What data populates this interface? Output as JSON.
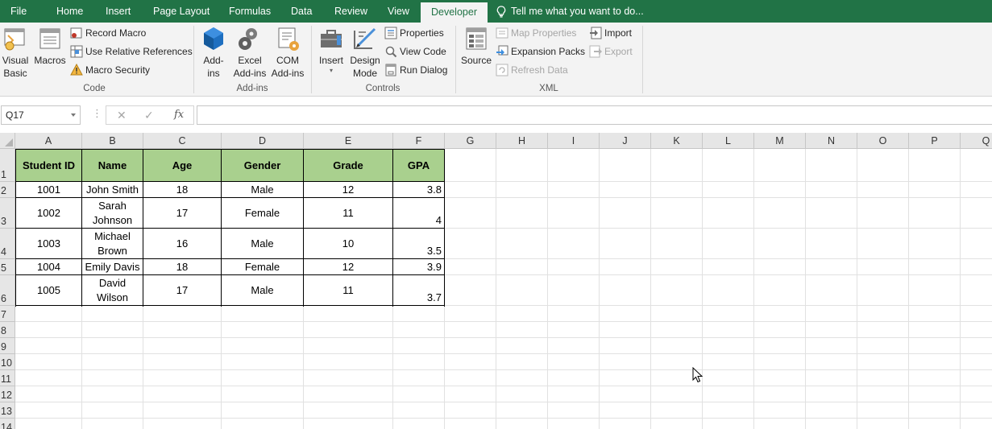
{
  "tabs": [
    {
      "label": "File"
    },
    {
      "label": "Home"
    },
    {
      "label": "Insert"
    },
    {
      "label": "Page Layout"
    },
    {
      "label": "Formulas"
    },
    {
      "label": "Data"
    },
    {
      "label": "Review"
    },
    {
      "label": "View"
    },
    {
      "label": "Developer"
    }
  ],
  "active_tab": "Developer",
  "tell_me": "Tell me what you want to do...",
  "ribbon": {
    "code": {
      "label": "Code",
      "visual_basic": [
        "Visual",
        "Basic"
      ],
      "macros": "Macros",
      "record_macro": "Record Macro",
      "relative_refs": "Use Relative References",
      "macro_security": "Macro Security"
    },
    "addins": {
      "label": "Add-ins",
      "addins": [
        "Add-",
        "ins"
      ],
      "excel_addins": [
        "Excel",
        "Add-ins"
      ],
      "com_addins": [
        "COM",
        "Add-ins"
      ]
    },
    "controls": {
      "label": "Controls",
      "insert": "Insert",
      "design_mode": [
        "Design",
        "Mode"
      ],
      "properties": "Properties",
      "view_code": "View Code",
      "run_dialog": "Run Dialog"
    },
    "xml": {
      "label": "XML",
      "source": "Source",
      "map_properties": "Map Properties",
      "expansion_packs": "Expansion Packs",
      "refresh_data": "Refresh Data",
      "import": "Import",
      "export": "Export"
    }
  },
  "formula_bar": {
    "name_box": "Q17",
    "fx": "fx",
    "formula": ""
  },
  "columns": [
    "A",
    "B",
    "C",
    "D",
    "E",
    "F",
    "G",
    "H",
    "I",
    "J",
    "K",
    "L",
    "M",
    "N",
    "O",
    "P",
    "Q"
  ],
  "rows": [
    "1",
    "2",
    "3",
    "4",
    "5",
    "6",
    "7",
    "8",
    "9",
    "10",
    "11",
    "12",
    "13",
    "14"
  ],
  "table": {
    "headers": [
      "Student ID",
      "Name",
      "Age",
      "Gender",
      "Grade",
      "GPA"
    ],
    "rows": [
      {
        "id": "1001",
        "name": [
          "John Smith"
        ],
        "age": "18",
        "gender": "Male",
        "grade": "12",
        "gpa": "3.8"
      },
      {
        "id": "1002",
        "name": [
          "Sarah",
          "Johnson"
        ],
        "age": "17",
        "gender": "Female",
        "grade": "11",
        "gpa": "4"
      },
      {
        "id": "1003",
        "name": [
          "Michael",
          "Brown"
        ],
        "age": "16",
        "gender": "Male",
        "grade": "10",
        "gpa": "3.5"
      },
      {
        "id": "1004",
        "name": [
          "Emily Davis"
        ],
        "age": "18",
        "gender": "Female",
        "grade": "12",
        "gpa": "3.9"
      },
      {
        "id": "1005",
        "name": [
          "David",
          "Wilson"
        ],
        "age": "17",
        "gender": "Male",
        "grade": "11",
        "gpa": "3.7"
      }
    ]
  },
  "colors": {
    "brand": "#217346",
    "header_fill": "#a9d08e"
  }
}
